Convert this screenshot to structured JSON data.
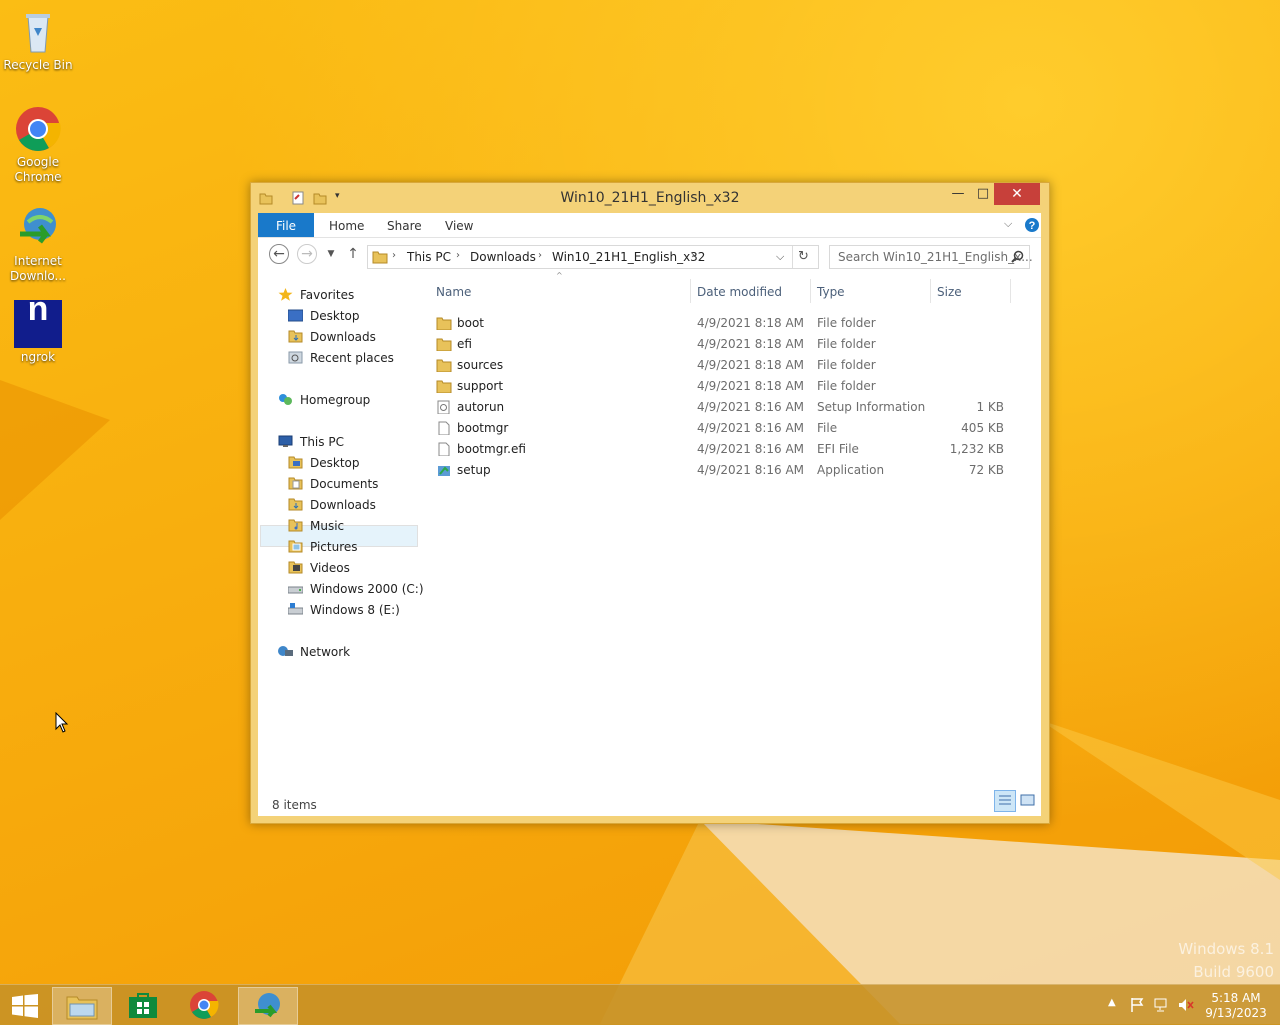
{
  "desktop": {
    "icons": [
      {
        "label": "Recycle Bin",
        "icon": "recycle-bin-icon"
      },
      {
        "label": "Google Chrome",
        "icon": "chrome-icon"
      },
      {
        "label": "Internet Downlo...",
        "icon": "internet-download-manager-icon"
      },
      {
        "label": "ngrok",
        "icon": "ngrok-icon"
      }
    ],
    "watermark": {
      "line1": "Windows 8.1",
      "line2": "Build 9600"
    }
  },
  "window": {
    "title": "Win10_21H1_English_x32",
    "controls": {
      "minimize": "—",
      "maximize": "□",
      "close": "✕"
    },
    "ribbon_tabs": [
      "File",
      "Home",
      "Share",
      "View"
    ],
    "address": {
      "breadcrumbs": [
        "This PC",
        "Downloads",
        "Win10_21H1_English_x32"
      ]
    },
    "search": {
      "placeholder": "Search Win10_21H1_English_x..."
    },
    "nav": {
      "favorites": {
        "label": "Favorites",
        "items": [
          "Desktop",
          "Downloads",
          "Recent places"
        ]
      },
      "homegroup": "Homegroup",
      "this_pc": {
        "label": "This PC",
        "items": [
          "Desktop",
          "Documents",
          "Downloads",
          "Music",
          "Pictures",
          "Videos",
          "Windows 2000 (C:)",
          "Windows 8 (E:)"
        ]
      },
      "network": "Network",
      "selected": "Downloads"
    },
    "columns": [
      "Name",
      "Date modified",
      "Type",
      "Size"
    ],
    "files": [
      {
        "name": "boot",
        "date": "4/9/2021 8:18 AM",
        "type": "File folder",
        "size": "",
        "icon": "folder-icon"
      },
      {
        "name": "efi",
        "date": "4/9/2021 8:18 AM",
        "type": "File folder",
        "size": "",
        "icon": "folder-icon"
      },
      {
        "name": "sources",
        "date": "4/9/2021 8:18 AM",
        "type": "File folder",
        "size": "",
        "icon": "folder-icon"
      },
      {
        "name": "support",
        "date": "4/9/2021 8:18 AM",
        "type": "File folder",
        "size": "",
        "icon": "folder-icon"
      },
      {
        "name": "autorun",
        "date": "4/9/2021 8:16 AM",
        "type": "Setup Information",
        "size": "1 KB",
        "icon": "setup-info-icon"
      },
      {
        "name": "bootmgr",
        "date": "4/9/2021 8:16 AM",
        "type": "File",
        "size": "405 KB",
        "icon": "file-icon"
      },
      {
        "name": "bootmgr.efi",
        "date": "4/9/2021 8:16 AM",
        "type": "EFI File",
        "size": "1,232 KB",
        "icon": "file-icon"
      },
      {
        "name": "setup",
        "date": "4/9/2021 8:16 AM",
        "type": "Application",
        "size": "72 KB",
        "icon": "setup-app-icon"
      }
    ],
    "status": "8 items"
  },
  "taskbar": {
    "items": [
      "start-button",
      "file-explorer",
      "store",
      "chrome",
      "internet-download-manager"
    ],
    "clock": {
      "time": "5:18 AM",
      "date": "9/13/2023"
    }
  }
}
